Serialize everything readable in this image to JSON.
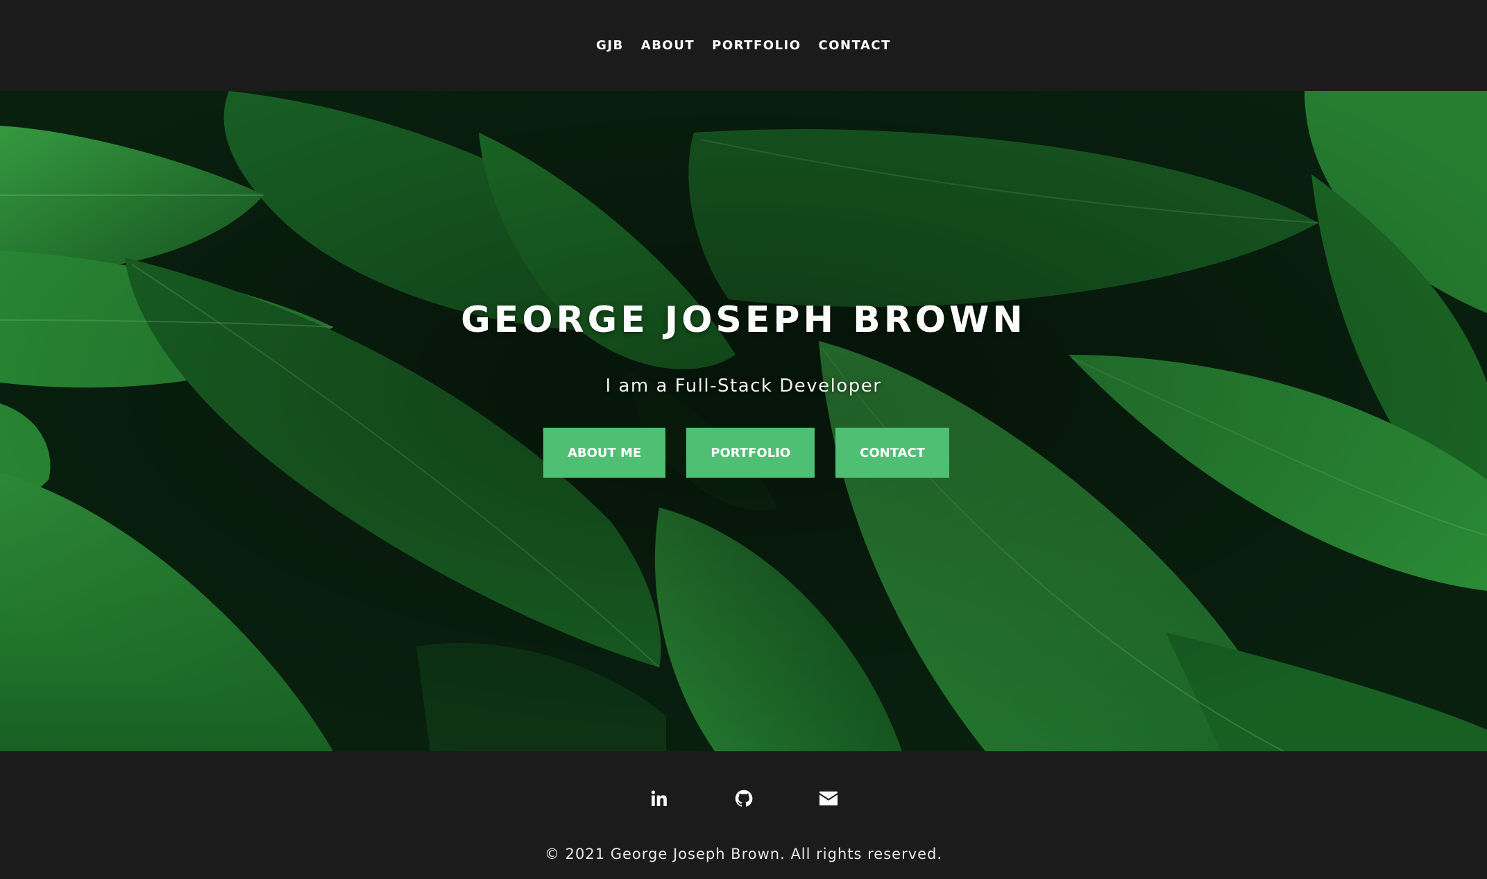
{
  "nav": {
    "items": [
      {
        "label": "GJB"
      },
      {
        "label": "ABOUT"
      },
      {
        "label": "PORTFOLIO"
      },
      {
        "label": "CONTACT"
      }
    ]
  },
  "hero": {
    "title": "GEORGE JOSEPH BROWN",
    "subtitle": "I am a Full-Stack Developer",
    "buttons": [
      {
        "label": "ABOUT ME"
      },
      {
        "label": "PORTFOLIO"
      },
      {
        "label": "CONTACT"
      }
    ]
  },
  "footer": {
    "social": [
      {
        "icon": "linkedin-icon"
      },
      {
        "icon": "github-icon"
      },
      {
        "icon": "envelope-icon"
      }
    ],
    "copyright": "© 2021 George Joseph Brown. All rights reserved."
  },
  "colors": {
    "background": "#1b1b1b",
    "accent": "#4fbf74",
    "text": "#ffffff",
    "leaf_dark": "#0b2a10",
    "leaf_mid": "#1f7a2c",
    "leaf_light": "#36a043"
  }
}
